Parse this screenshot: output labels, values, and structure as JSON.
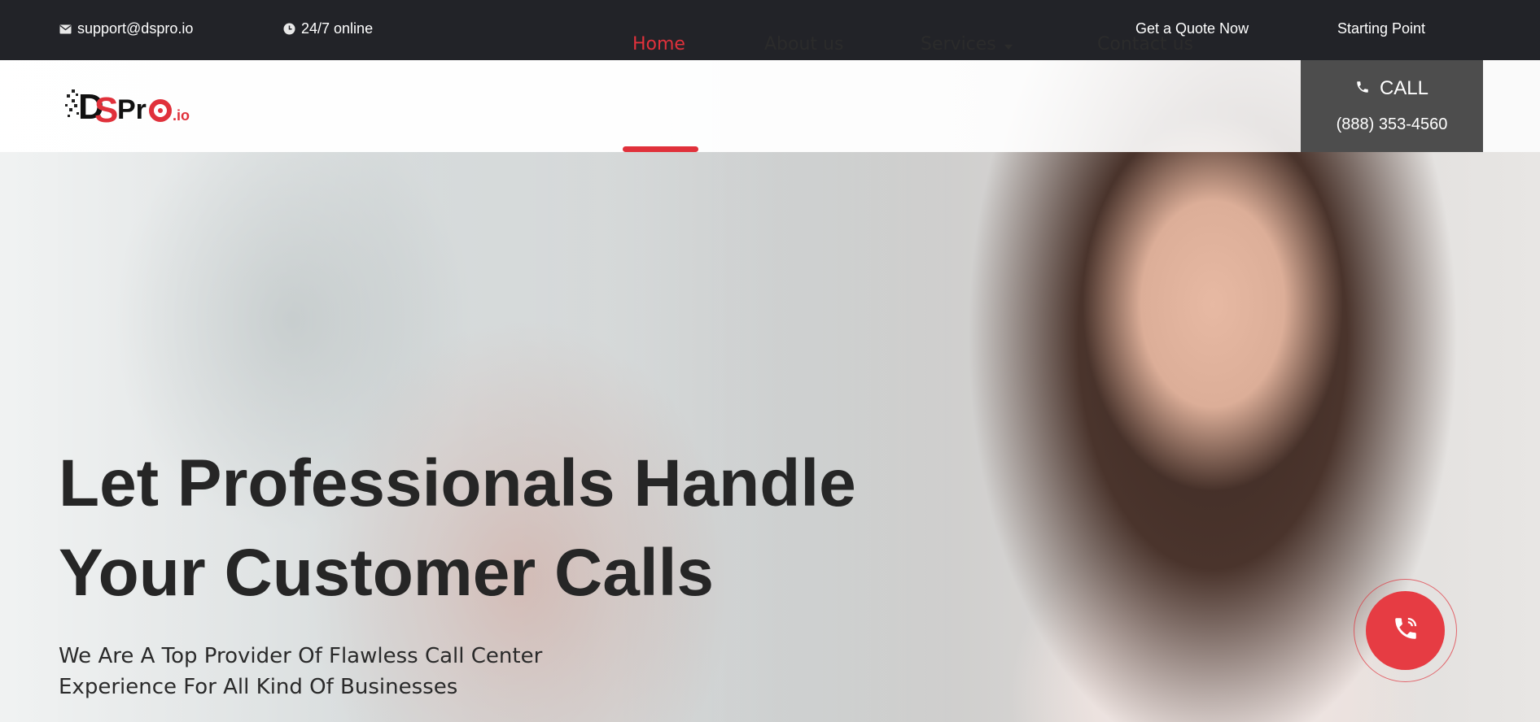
{
  "topbar": {
    "email": "support@dspro.io",
    "email_icon": "mail-icon",
    "availability": "24/7 online",
    "availability_icon": "clock-icon",
    "quote_link": "Get a Quote Now",
    "starting_link": "Starting Point"
  },
  "logo": {
    "brand_d": "D",
    "brand_s": "S",
    "brand_pr": "Pr",
    "brand_o": "o",
    "brand_tld": ".io"
  },
  "nav": {
    "items": [
      {
        "label": "Home",
        "active": true
      },
      {
        "label": "About us"
      },
      {
        "label": "Services",
        "has_dropdown": true
      },
      {
        "label": "Contact us"
      }
    ]
  },
  "call": {
    "label": "CALL",
    "icon": "phone-icon",
    "number": "(888) 353-4560"
  },
  "hero": {
    "headline_pre": "Let ",
    "headline_bold": "Professionals",
    "headline_post": " Handle",
    "headline_line2": "Your Customer Calls",
    "subheading_line1": "We Are A Top Provider Of Flawless Call Center",
    "subheading_line2": "Experience For All Kind Of Businesses"
  },
  "floating_button": {
    "icon": "phone-call-icon"
  },
  "colors": {
    "accent": "#e0313b",
    "topbar_bg": "#222328",
    "call_box_bg": "#4d4d4d",
    "text_dark": "#262626"
  }
}
